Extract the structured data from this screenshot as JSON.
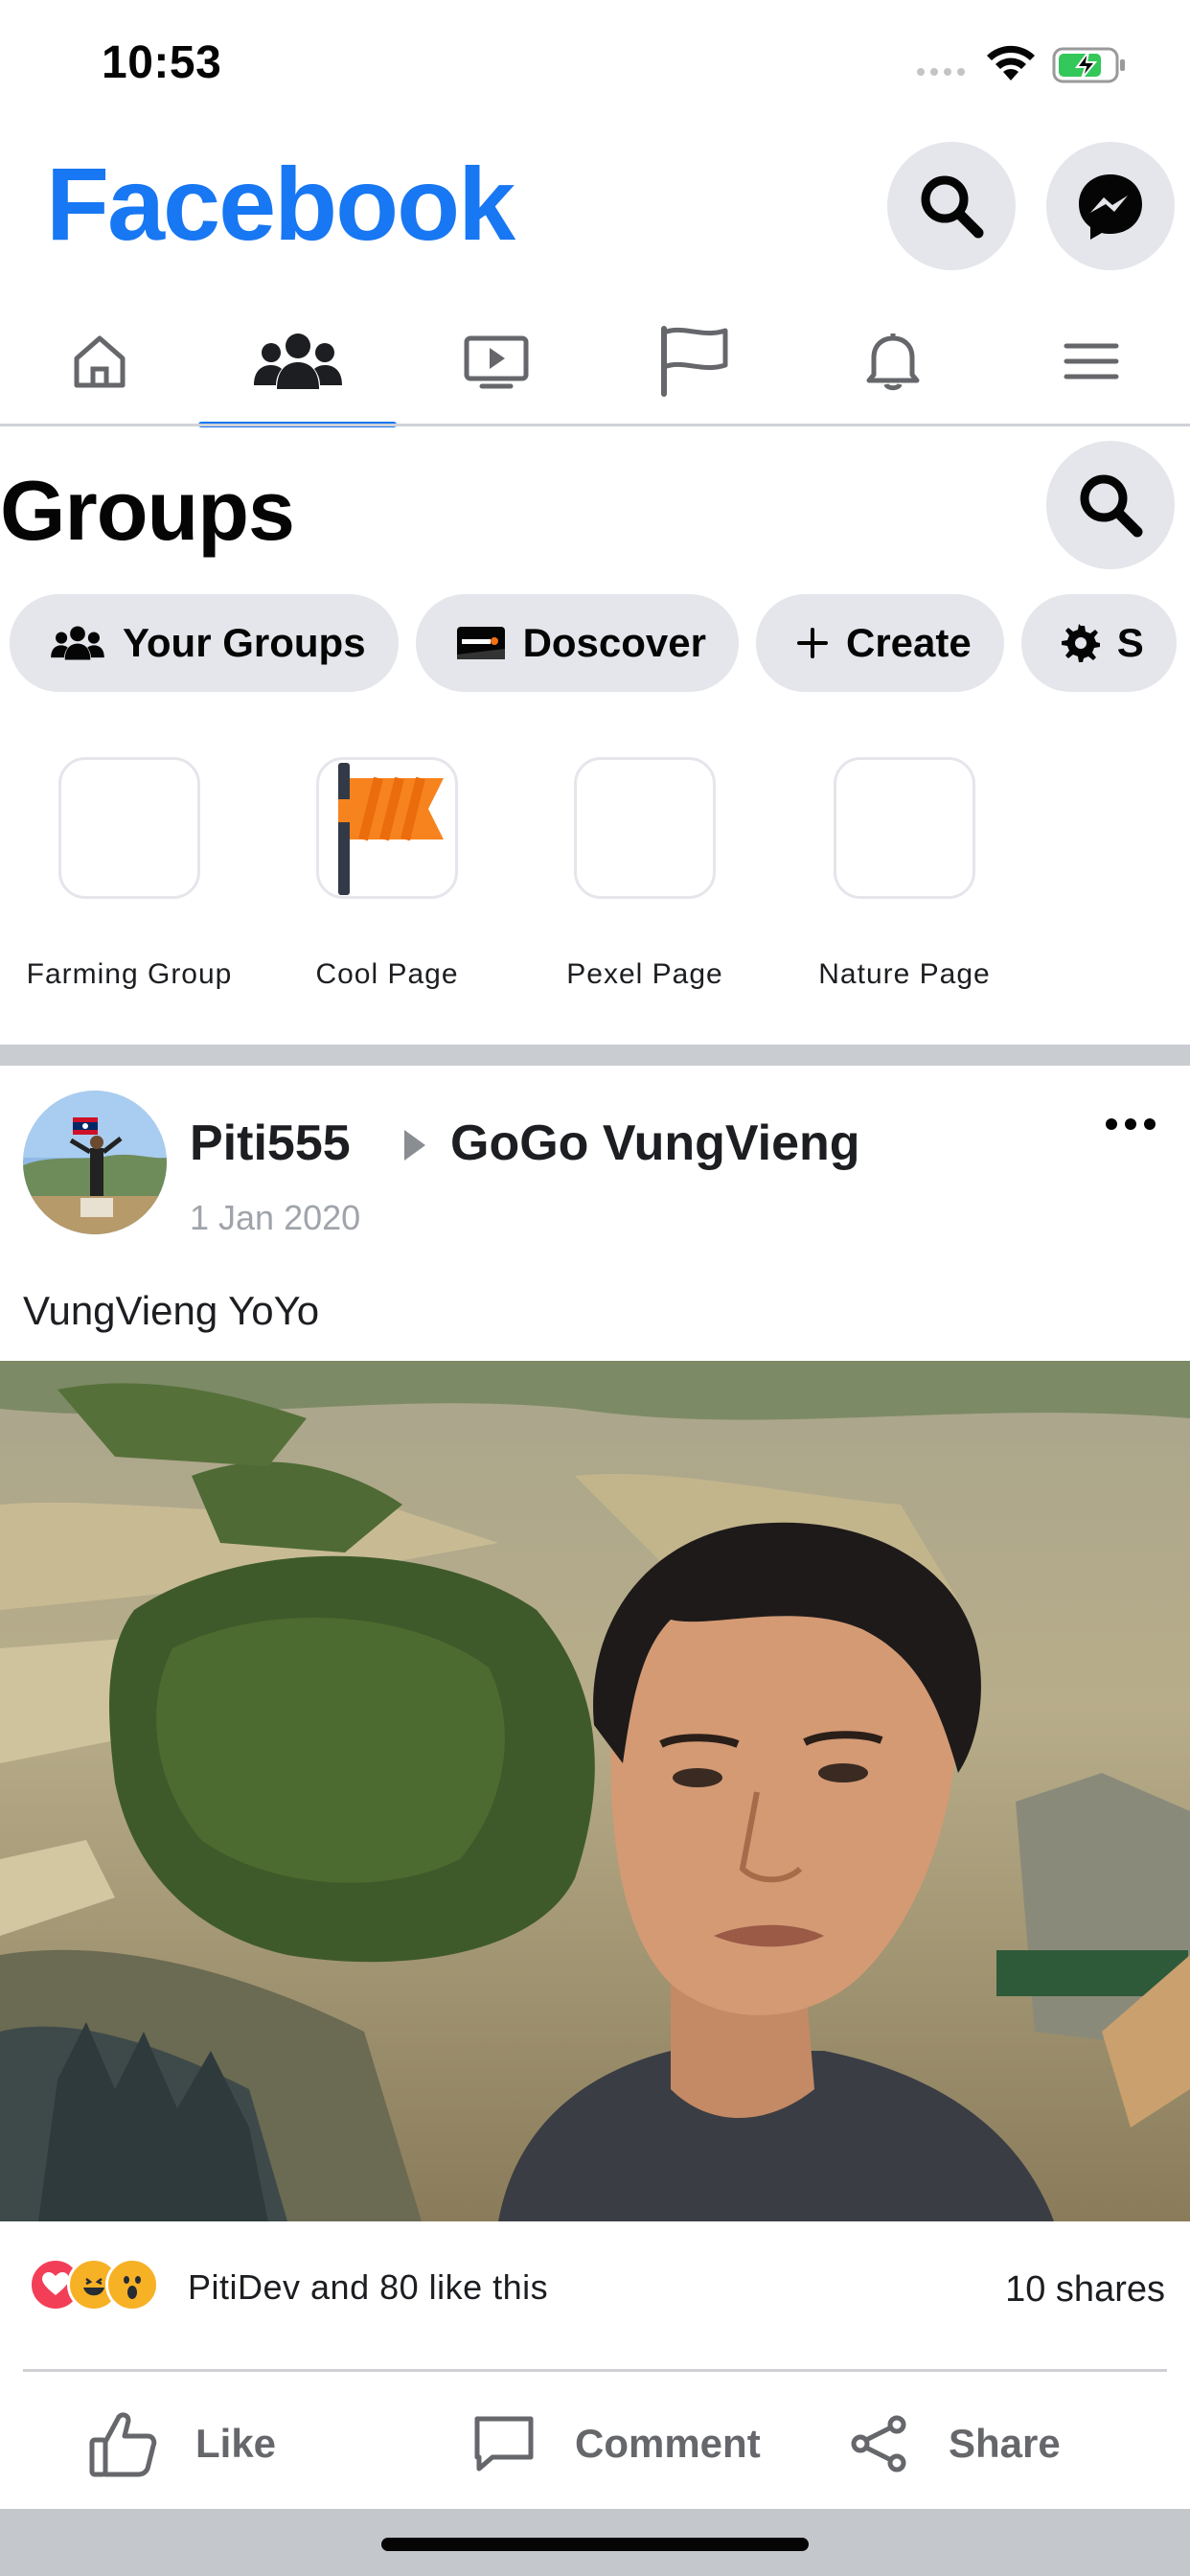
{
  "status_bar": {
    "time": "10:53"
  },
  "header": {
    "brand": "Facebook"
  },
  "nav_tabs": [
    {
      "id": "home",
      "icon": "home-icon"
    },
    {
      "id": "groups",
      "icon": "groups-icon",
      "active": true
    },
    {
      "id": "watch",
      "icon": "video-icon"
    },
    {
      "id": "pages",
      "icon": "flag-icon"
    },
    {
      "id": "notifications",
      "icon": "bell-icon"
    },
    {
      "id": "menu",
      "icon": "hamburger-icon"
    }
  ],
  "groups": {
    "title": "Groups",
    "chips": [
      {
        "label": "Your Groups",
        "icon": "people-icon"
      },
      {
        "label": "Doscover",
        "icon": "discover-card-icon"
      },
      {
        "label": "Create",
        "icon": "plus-icon"
      },
      {
        "label": "S",
        "icon": "gear-icon"
      }
    ],
    "shortcuts": [
      {
        "label": "Farming Group"
      },
      {
        "label": "Cool Page",
        "icon": "orange-flag-icon"
      },
      {
        "label": "Pexel Page"
      },
      {
        "label": "Nature Page"
      }
    ]
  },
  "post": {
    "author": "Piti555",
    "group": "GoGo VungVieng",
    "date": "1 Jan 2020",
    "text": "VungVieng YoYo",
    "likes_text": "PitiDev and 80 like this",
    "shares_text": "10 shares",
    "actions": {
      "like": "Like",
      "comment": "Comment",
      "share": "Share"
    }
  },
  "colors": {
    "brand": "#1877f2",
    "chip_bg": "#e4e6eb",
    "muted_text": "#65676b"
  }
}
